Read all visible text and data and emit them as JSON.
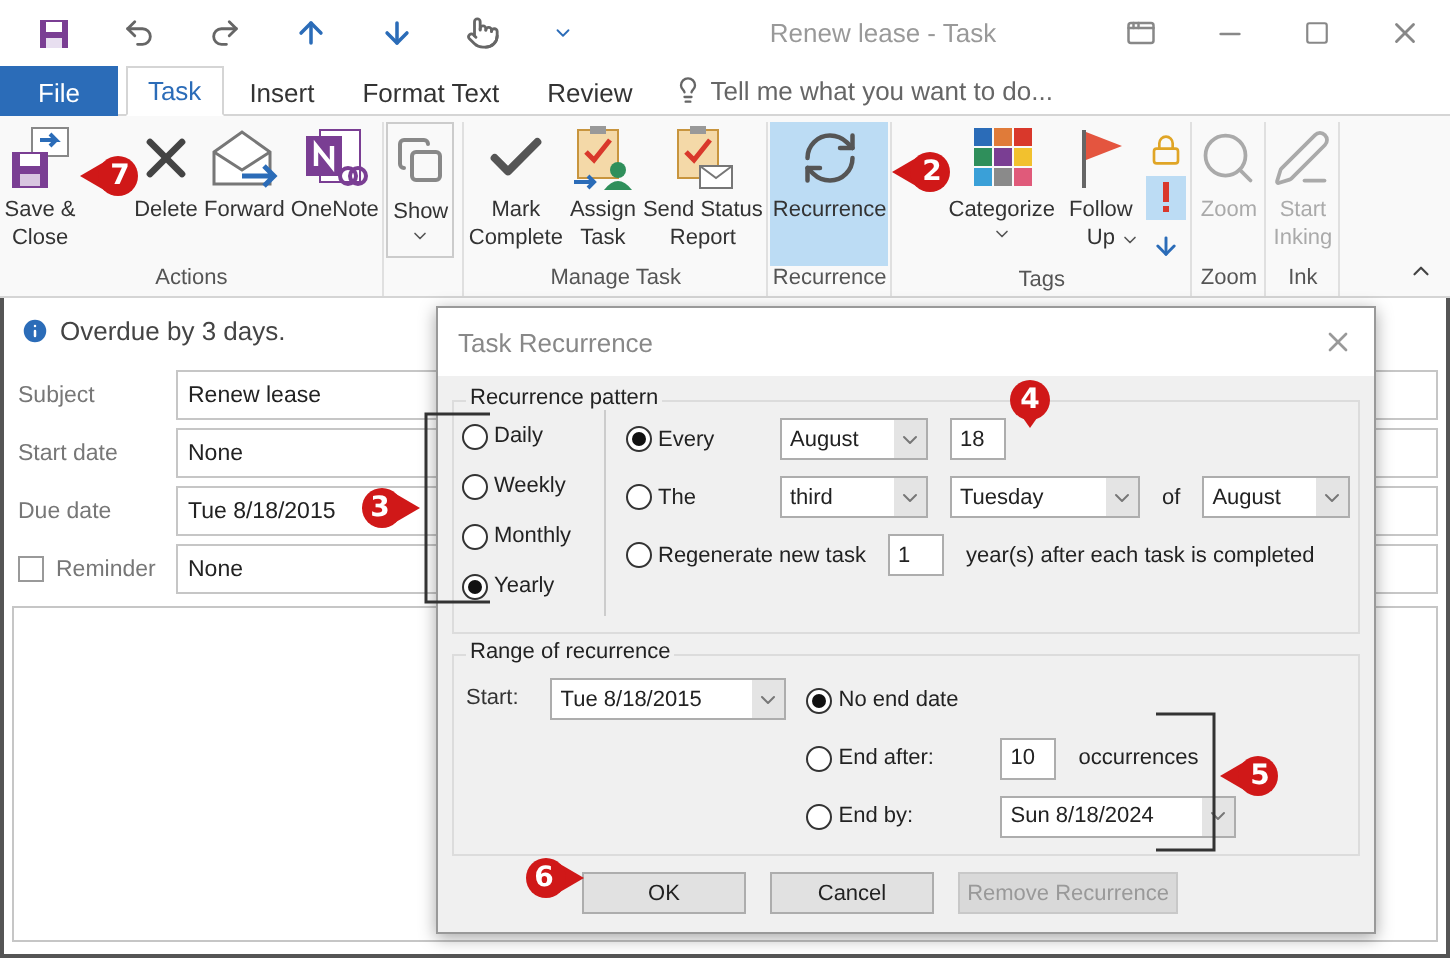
{
  "window": {
    "title": "Renew lease - Task"
  },
  "tabs": [
    {
      "label": "File",
      "kind": "file",
      "selected": false
    },
    {
      "label": "Task",
      "kind": "tab",
      "selected": true
    },
    {
      "label": "Insert",
      "kind": "tab",
      "selected": false
    },
    {
      "label": "Format Text",
      "kind": "tab",
      "selected": false
    },
    {
      "label": "Review",
      "kind": "tab",
      "selected": false
    }
  ],
  "tell_me": {
    "placeholder": "Tell me what you want to do..."
  },
  "ribbon": {
    "groups": [
      {
        "label": "Actions",
        "buttons": [
          {
            "label": "Save &\nClose",
            "kind": "save-close",
            "selected": false,
            "disabled": false,
            "dropdown": false
          },
          {
            "label": "Delete",
            "kind": "delete",
            "selected": false,
            "disabled": false,
            "dropdown": false
          },
          {
            "label": "Forward",
            "kind": "forward",
            "selected": false,
            "disabled": false,
            "dropdown": false
          },
          {
            "label": "OneNote",
            "kind": "onenote",
            "selected": false,
            "disabled": false,
            "dropdown": false
          }
        ]
      },
      {
        "buttons": [
          {
            "label": "Show",
            "kind": "show",
            "selected": false,
            "disabled": false,
            "dropdown": true
          }
        ]
      },
      {
        "label": "Manage Task",
        "buttons": [
          {
            "label": "Mark\nComplete",
            "kind": "check",
            "selected": false,
            "disabled": false,
            "dropdown": false
          },
          {
            "label": "Assign\nTask",
            "kind": "assign",
            "selected": false,
            "disabled": false,
            "dropdown": false
          },
          {
            "label": "Send Status\nReport",
            "kind": "report",
            "selected": false,
            "disabled": false,
            "dropdown": false
          }
        ]
      },
      {
        "label": "Recurrence",
        "buttons": [
          {
            "label": "Recurrence",
            "kind": "recurrence",
            "selected": true,
            "disabled": false,
            "dropdown": false
          }
        ]
      },
      {
        "label": "Tags",
        "buttons": [
          {
            "label": "Categorize",
            "kind": "categorize",
            "selected": false,
            "disabled": false,
            "dropdown": true
          },
          {
            "label": "Follow\nUp",
            "kind": "flag",
            "selected": false,
            "disabled": false,
            "dropdown": true
          }
        ],
        "toggles": [
          {
            "kind": "private",
            "selected": false
          },
          {
            "kind": "high",
            "selected": true
          },
          {
            "kind": "low",
            "selected": false
          }
        ]
      },
      {
        "label": "Zoom",
        "buttons": [
          {
            "label": "Zoom",
            "kind": "zoom",
            "selected": false,
            "disabled": true,
            "dropdown": false
          }
        ]
      },
      {
        "label": "Ink",
        "buttons": [
          {
            "label": "Start\nInking",
            "kind": "ink",
            "selected": false,
            "disabled": true,
            "dropdown": false
          }
        ]
      }
    ]
  },
  "info_bar": {
    "text": "Overdue by 3 days."
  },
  "form": {
    "fields": [
      {
        "label": "Subject",
        "kind": "text",
        "value": "Renew lease"
      },
      {
        "label": "Start date",
        "kind": "text",
        "value": "None"
      },
      {
        "label": "Due date",
        "kind": "text",
        "value": "Tue 8/18/2015"
      },
      {
        "label": "Reminder",
        "kind": "checkbox",
        "checked": false,
        "value": "None"
      }
    ]
  },
  "dialog": {
    "title": "Task Recurrence",
    "pattern": {
      "legend": "Recurrence pattern",
      "frequencies": [
        {
          "label": "Daily",
          "selected": false
        },
        {
          "label": "Weekly",
          "selected": false
        },
        {
          "label": "Monthly",
          "selected": false
        },
        {
          "label": "Yearly",
          "selected": true
        }
      ],
      "options": [
        {
          "label": "Every",
          "selected": true,
          "controls": [
            {
              "kind": "dropdown",
              "value": "August"
            },
            {
              "kind": "input",
              "value": "18"
            }
          ]
        },
        {
          "label": "The",
          "selected": false,
          "controls": [
            {
              "kind": "dropdown",
              "value": "third"
            },
            {
              "kind": "dropdown",
              "value": "Tuesday"
            },
            {
              "kind": "text",
              "value": "of"
            },
            {
              "kind": "dropdown",
              "value": "August"
            }
          ]
        },
        {
          "label": "Regenerate new task",
          "selected": false,
          "controls": [
            {
              "kind": "input",
              "value": "1"
            },
            {
              "kind": "text",
              "value": "year(s) after each task is completed"
            }
          ]
        }
      ]
    },
    "range": {
      "legend": "Range of recurrence",
      "start_label": "Start:",
      "start_value": "Tue 8/18/2015",
      "ends": [
        {
          "label": "No end date",
          "selected": true
        },
        {
          "label": "End after:",
          "selected": false,
          "controls": [
            {
              "kind": "input",
              "value": "10"
            },
            {
              "kind": "text",
              "value": "occurrences"
            }
          ]
        },
        {
          "label": "End by:",
          "selected": false,
          "controls": [
            {
              "kind": "dropdown",
              "value": "Sun 8/18/2024"
            }
          ]
        }
      ]
    },
    "buttons": [
      {
        "label": "OK",
        "disabled": false
      },
      {
        "label": "Cancel",
        "disabled": false
      },
      {
        "label": "Remove Recurrence",
        "disabled": true
      }
    ]
  },
  "callouts": [
    {
      "number": "7"
    },
    {
      "number": "2"
    },
    {
      "number": "3"
    },
    {
      "number": "4"
    },
    {
      "number": "5"
    },
    {
      "number": "6"
    }
  ]
}
